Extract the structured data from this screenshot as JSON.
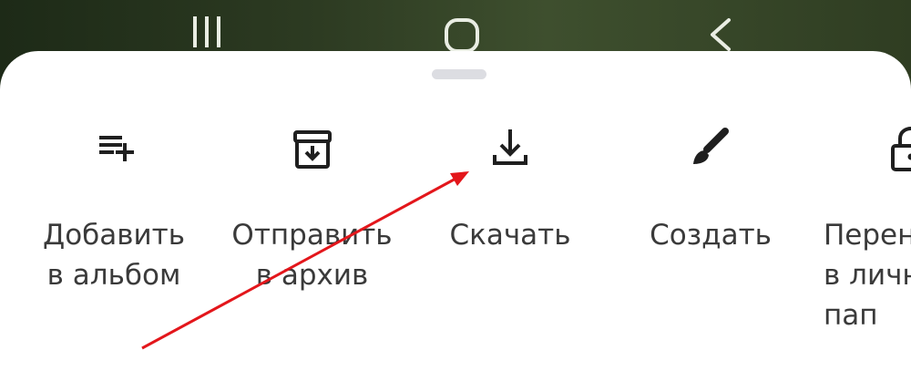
{
  "nav": {
    "buttons": [
      "recents",
      "home",
      "back"
    ]
  },
  "actions": [
    {
      "key": "add",
      "label": "Добавить\nв альбом",
      "icon": "playlist-add-icon"
    },
    {
      "key": "archive",
      "label": "Отправить\nв архив",
      "icon": "archive-icon"
    },
    {
      "key": "download",
      "label": "Скачать",
      "icon": "download-icon"
    },
    {
      "key": "create",
      "label": "Создать",
      "icon": "brush-icon"
    },
    {
      "key": "move",
      "label": "Перен\nв личн\nпап",
      "icon": "lock-icon"
    }
  ],
  "colors": {
    "icon": "#1f1f1f",
    "text": "#3a3a3a",
    "annotation": "#e3161b",
    "sheet": "#ffffff",
    "handle": "#dcdde2"
  }
}
